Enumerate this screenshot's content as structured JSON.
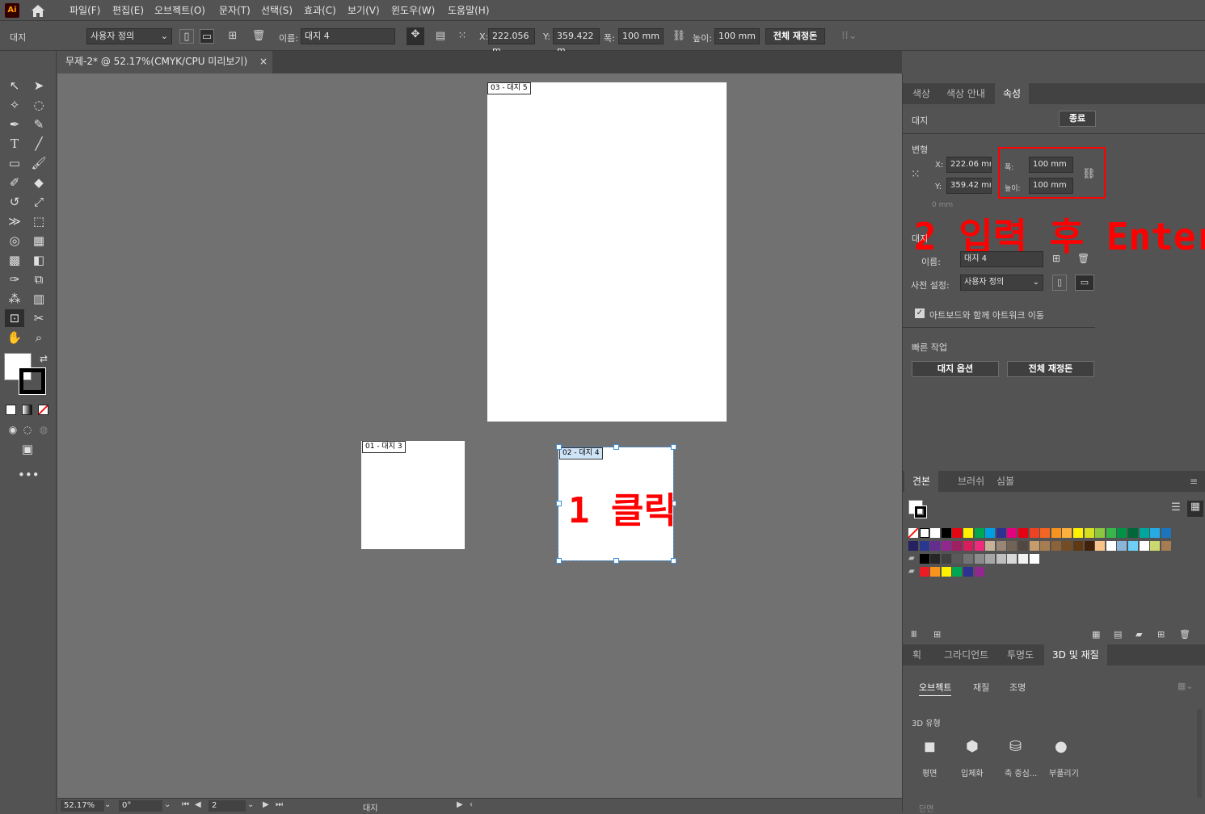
{
  "app": {
    "logo": "Ai"
  },
  "menu": [
    "파일(F)",
    "편집(E)",
    "오브젝트(O)",
    "문자(T)",
    "선택(S)",
    "효과(C)",
    "보기(V)",
    "윈도우(W)",
    "도움말(H)"
  ],
  "control": {
    "mode": "대지",
    "preset": "사용자 정의",
    "name_label": "이름:",
    "name_value": "대지 4",
    "x_label": "X:",
    "x_value": "222.056 m",
    "y_label": "Y:",
    "y_value": "359.422 m",
    "w_label": "폭:",
    "w_value": "100 mm",
    "h_label": "높이:",
    "h_value": "100 mm",
    "rearrange": "전체 재정돈"
  },
  "doc": {
    "tab_title": "무제-2* @ 52.17%(CMYK/CPU 미리보기)",
    "close": "×"
  },
  "artboards": [
    {
      "label": "03 - 대지 5"
    },
    {
      "label": "01 - 대지 3"
    },
    {
      "label": "02 - 대지 4"
    }
  ],
  "annotations": {
    "click": "1 클릭",
    "enter": "2 입력 후 Enter"
  },
  "status": {
    "zoom": "52.17%",
    "rotation": "0°",
    "artboard_num": "2",
    "mode": "대지"
  },
  "panel_top": {
    "tabs": [
      "색상",
      "색상 안내",
      "속성"
    ],
    "section_artboard": "대지",
    "exit": "종료",
    "transform": "변형",
    "x_label": "X:",
    "x_value": "222.06 mr",
    "y_label": "Y:",
    "y_value": "359.42 mr",
    "w_label": "폭:",
    "w_value": "100 mm",
    "h_label": "높이:",
    "h_value": "100 mm",
    "angle": "0 mm",
    "section_artboard2": "대지",
    "name_label": "이름:",
    "name_value": "대지 4",
    "preset_label": "사전 설정:",
    "preset_value": "사용자 정의",
    "move_with_artboard": "아트보드와 함께 아트워크 이동",
    "quick_actions": "빠른 작업",
    "artboard_options": "대지 옵션",
    "rearrange_all": "전체 재정돈"
  },
  "panel_swatches": {
    "tabs": [
      "견본",
      "브러쉬",
      "심볼"
    ]
  },
  "panel_3d": {
    "tabs": [
      "획",
      "그라디언트",
      "투명도",
      "3D 및 재질"
    ],
    "subtabs": [
      "오브젝트",
      "재질",
      "조명"
    ],
    "type_label": "3D 유형",
    "types": [
      "평면",
      "입체화",
      "축 중심...",
      "부풀리기"
    ],
    "bottom": "단면"
  }
}
